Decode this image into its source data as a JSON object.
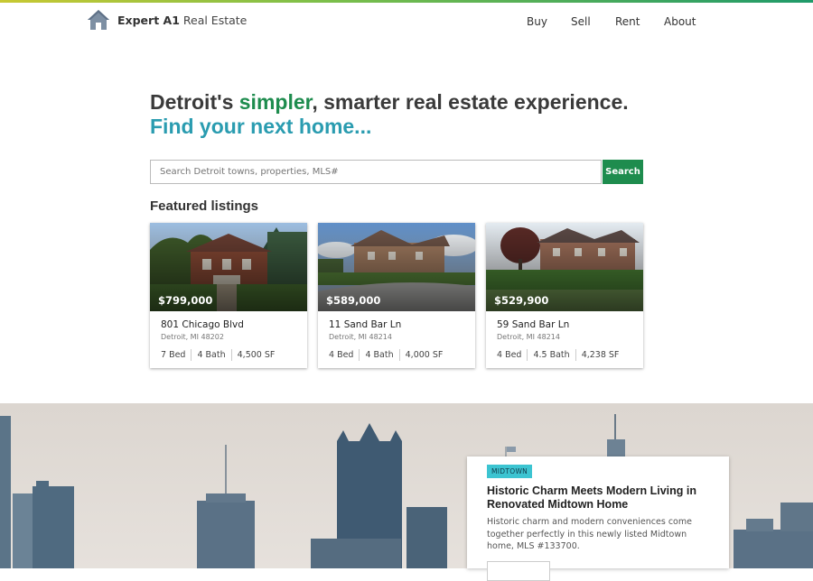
{
  "brand": {
    "bold": "Expert A1",
    "light": "Real Estate",
    "icon": "house-icon"
  },
  "nav": [
    "Buy",
    "Sell",
    "Rent",
    "About"
  ],
  "hero": {
    "line1_before": "Detroit's ",
    "line1_highlight": "simpler",
    "line1_after": ", smarter real estate experience.",
    "line2": "Find your next home..."
  },
  "search": {
    "placeholder": "Search Detroit towns, properties, MLS#",
    "value": "",
    "button_label": "Search"
  },
  "featured": {
    "title": "Featured listings",
    "listings": [
      {
        "price": "$799,000",
        "address": "801 Chicago Blvd",
        "city": "Detroit, MI 48202",
        "beds": "7 Bed",
        "baths": "4 Bath",
        "sqft": "4,500 SF"
      },
      {
        "price": "$589,000",
        "address": "11 Sand Bar Ln",
        "city": "Detroit, MI 48214",
        "beds": "4 Bed",
        "baths": "4 Bath",
        "sqft": "4,000 SF"
      },
      {
        "price": "$529,900",
        "address": "59 Sand Bar Ln",
        "city": "Detroit, MI 48214",
        "beds": "4 Bed",
        "baths": "4.5 Bath",
        "sqft": "4,238 SF"
      }
    ]
  },
  "article": {
    "tag": "MIDTOWN",
    "title": "Historic Charm Meets Modern Living in Renovated Midtown Home",
    "body": "Historic charm and modern conveniences come together perfectly in this newly listed Midtown home, MLS #133700."
  },
  "colors": {
    "accent_green": "#1e8c4e",
    "accent_teal": "#2a9cb0",
    "tag_cyan": "#3cc4d1"
  }
}
